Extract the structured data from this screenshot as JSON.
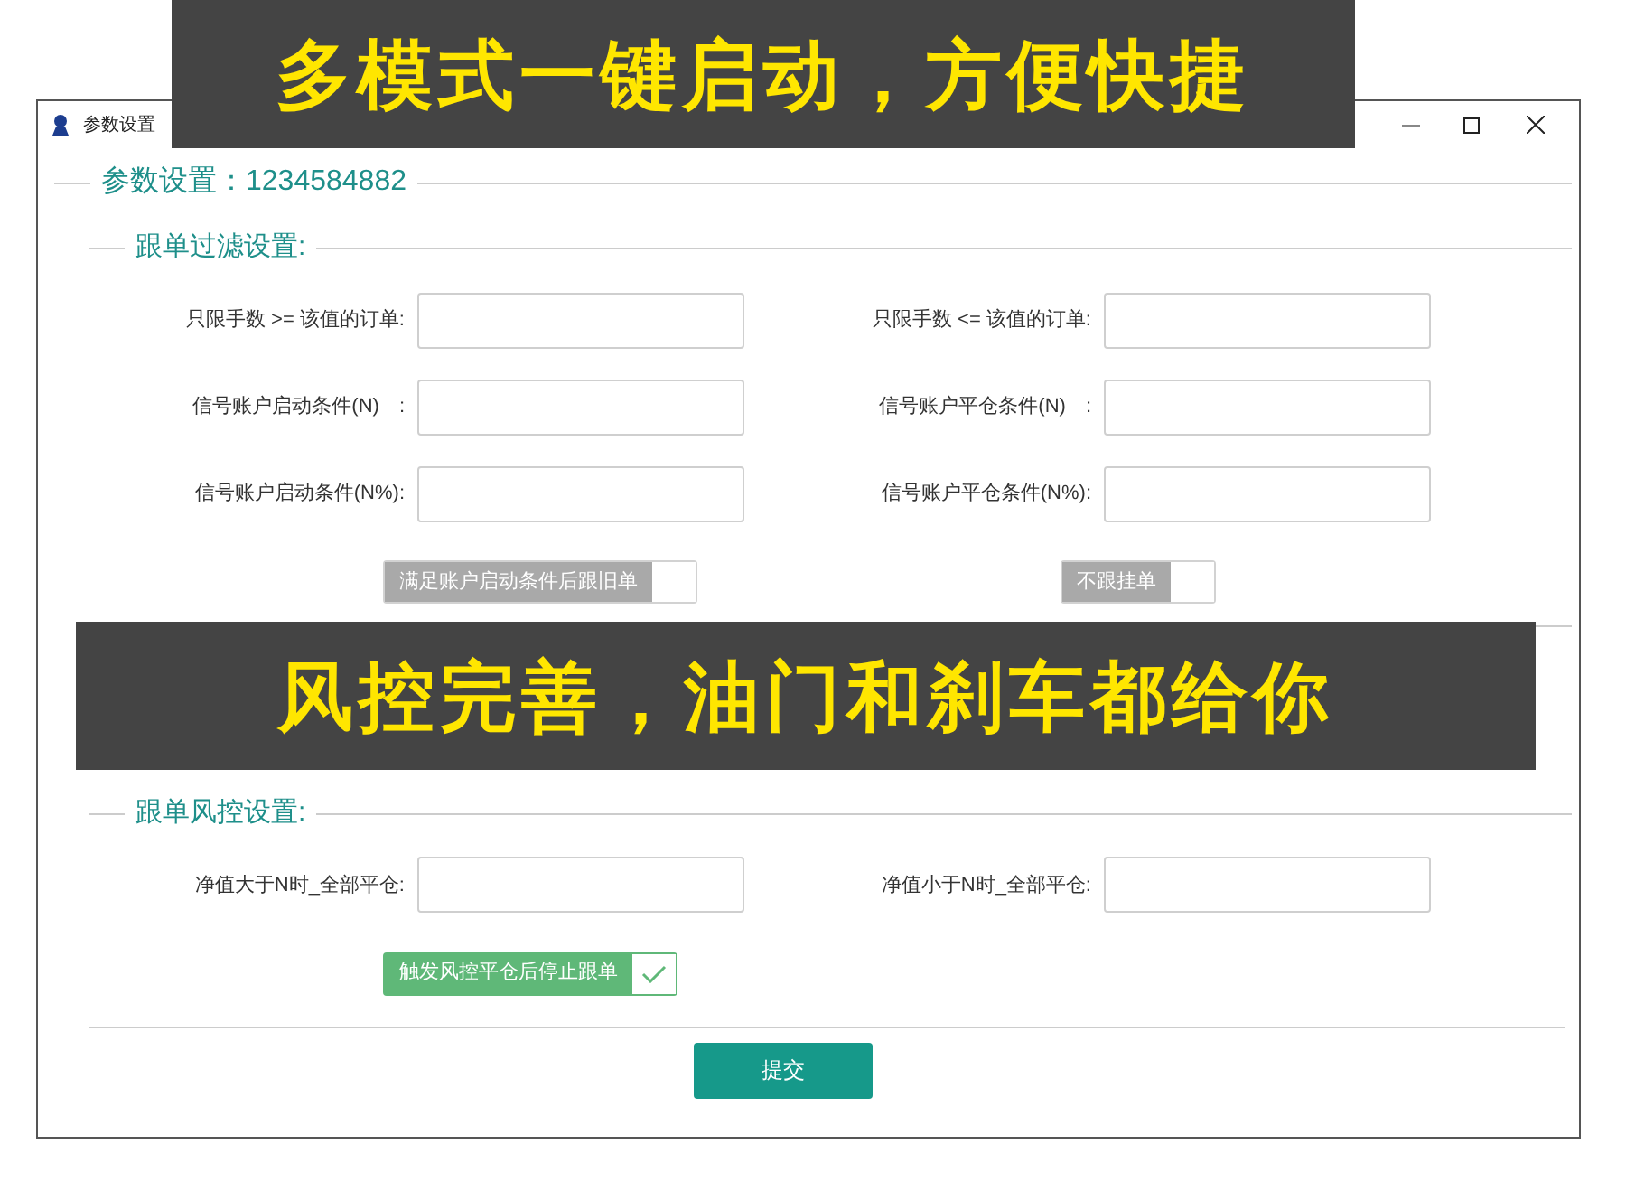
{
  "window": {
    "title": "参数设置"
  },
  "header": {
    "label": "参数设置：",
    "account": "1234584882"
  },
  "sections": [
    {
      "title": "跟单过滤设置:",
      "rows": [
        {
          "left": {
            "label": "只限手数 >= 该值的订单:"
          },
          "right": {
            "label": "只限手数 <= 该值的订单:"
          }
        },
        {
          "left": {
            "label": "信号账户启动条件(N)　:"
          },
          "right": {
            "label": "信号账户平仓条件(N)　:"
          }
        },
        {
          "left": {
            "label": "信号账户启动条件(N%):"
          },
          "right": {
            "label": "信号账户平仓条件(N%):"
          }
        }
      ],
      "toggles": [
        {
          "label": "满足账户启动条件后跟旧单",
          "checked": false
        },
        {
          "label": "不跟挂单",
          "checked": false
        }
      ]
    },
    {
      "title": "跟单风控设置:",
      "rows": [
        {
          "left": {
            "label": "净值大于N时_全部平仓:"
          },
          "right": {
            "label": "净值小于N时_全部平仓:"
          }
        }
      ],
      "toggles": [
        {
          "label": "触发风控平仓后停止跟单",
          "checked": true
        }
      ]
    }
  ],
  "submit": "提交",
  "banners": [
    {
      "text": "多模式一键启动，方便快捷"
    },
    {
      "text": "风控完善，油门和刹车都给你"
    }
  ]
}
